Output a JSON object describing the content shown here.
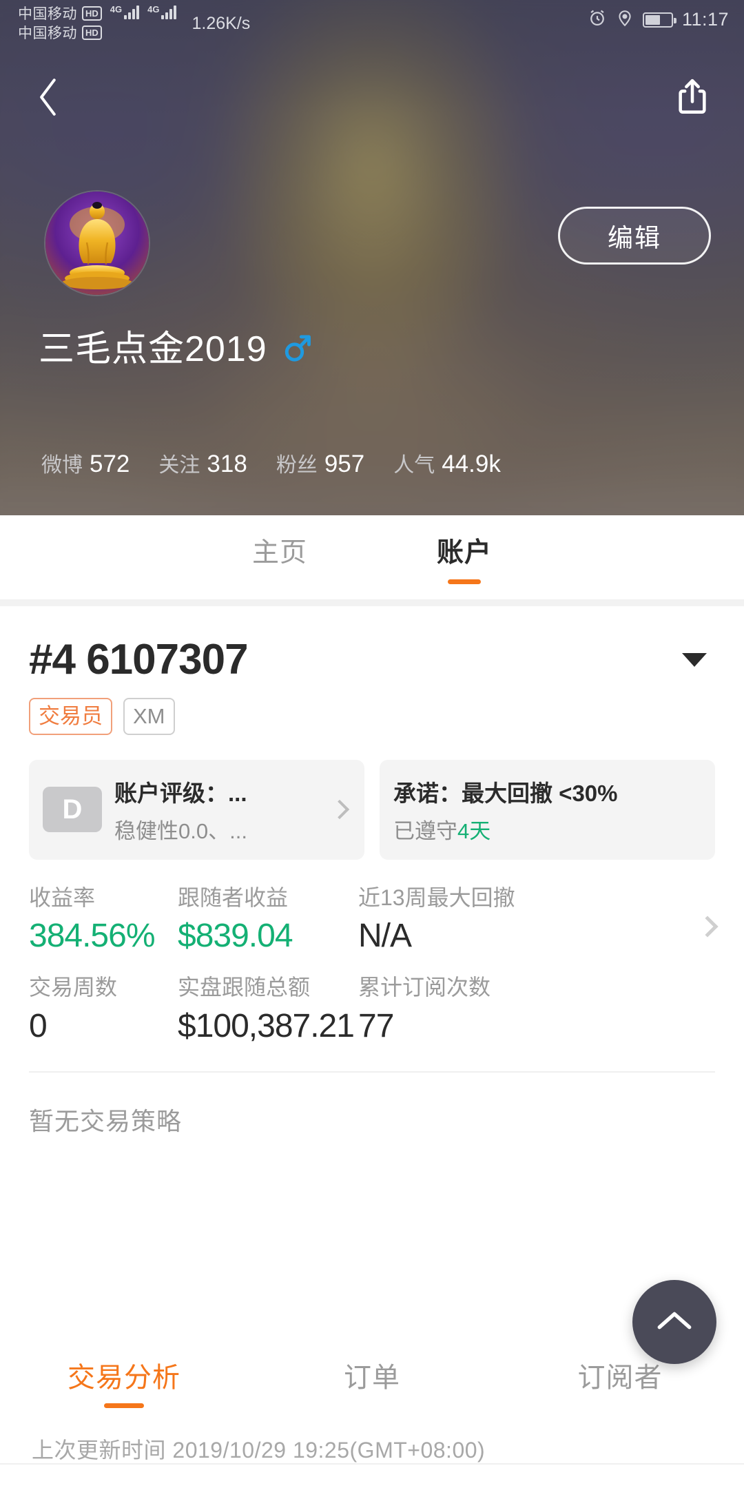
{
  "statusbar": {
    "carrier_primary": "中国移动",
    "carrier_secondary": "中国移动",
    "hd_label": "HD",
    "network_primary": "4G",
    "network_secondary": "4G",
    "speed": "1.26K/s",
    "time": "11:17",
    "icons": [
      "alarm-icon",
      "location-icon",
      "battery-icon"
    ]
  },
  "hero": {
    "back_icon": "back-chevron-icon",
    "share_icon": "share-icon",
    "edit_label": "编辑",
    "username": "三毛点金2019",
    "gender_symbol": "♂",
    "gender_color": "#1f9ae0",
    "avatar_name": "buddha-avatar",
    "stats": [
      {
        "label": "微博",
        "value": "572"
      },
      {
        "label": "关注",
        "value": "318"
      },
      {
        "label": "粉丝",
        "value": "957"
      },
      {
        "label": "人气",
        "value": "44.9k"
      }
    ]
  },
  "tabs": [
    {
      "label": "主页",
      "active": false
    },
    {
      "label": "账户",
      "active": true
    }
  ],
  "account": {
    "number": "#4 6107307",
    "dropdown_icon": "chevron-down-icon",
    "badges": [
      {
        "label": "交易员",
        "type": "trader"
      },
      {
        "label": "XM",
        "type": "broker"
      }
    ]
  },
  "cards": [
    {
      "rating_letter": "D",
      "title": "账户评级：...",
      "subtitle": "稳健性0.0、...",
      "chevron": "chevron-right-icon"
    },
    {
      "title": "承诺：最大回撤 <30%",
      "subtitle_prefix": "已遵守",
      "subtitle_highlight": "4天"
    }
  ],
  "metrics": {
    "row1": [
      {
        "label": "收益率",
        "value": "384.56%",
        "color": "green"
      },
      {
        "label": "跟随者收益",
        "value": "$839.04",
        "color": "green"
      },
      {
        "label": "近13周最大回撤",
        "value": "N/A",
        "color": "dark"
      }
    ],
    "row2": [
      {
        "label": "交易周数",
        "value": "0",
        "color": "dark"
      },
      {
        "label": "实盘跟随总额",
        "value": "$100,387.21",
        "color": "dark"
      },
      {
        "label": "累计订阅次数",
        "value": "77",
        "color": "dark"
      }
    ]
  },
  "strategy": {
    "empty_text": "暂无交易策略"
  },
  "subtabs": [
    {
      "label": "交易分析",
      "active": true
    },
    {
      "label": "订单",
      "active": false
    },
    {
      "label": "订阅者",
      "active": false
    }
  ],
  "fab": {
    "icon": "chevron-up-icon"
  },
  "footer": {
    "text": "上次更新时间 2019/10/29 19:25(GMT+08:00)"
  },
  "colors": {
    "accent": "#f5761a",
    "green": "#14b074",
    "dark": "#2b2b2b",
    "muted": "#9b9b9b"
  }
}
